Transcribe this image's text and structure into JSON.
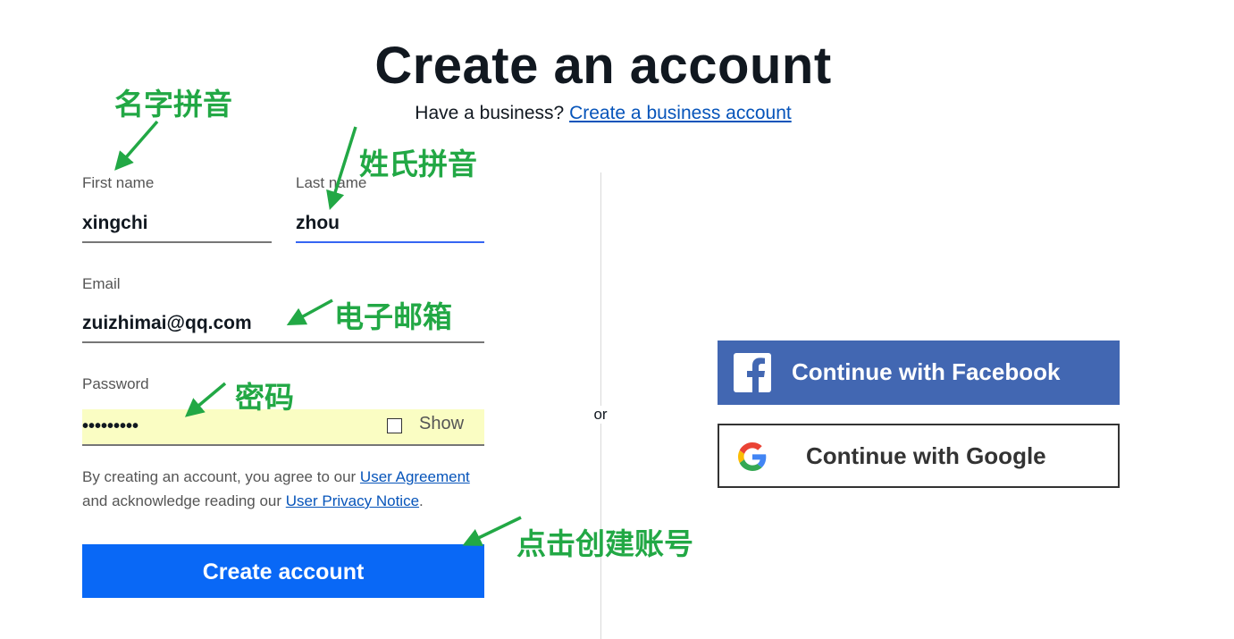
{
  "header": {
    "title": "Create an account",
    "business_prompt": "Have a business?",
    "business_link": "Create a business account"
  },
  "form": {
    "first_name": {
      "label": "First name",
      "value": "xingchi"
    },
    "last_name": {
      "label": "Last name",
      "value": "zhou"
    },
    "email": {
      "label": "Email",
      "value": "zuizhimai@qq.com"
    },
    "password": {
      "label": "Password",
      "value": "•••••••••",
      "show_label": "Show"
    },
    "legal": {
      "text_1": "By creating an account, you agree to our ",
      "link_1": "User Agreement",
      "text_2": " and acknowledge reading our ",
      "link_2": "User Privacy Notice",
      "text_3": "."
    },
    "submit_label": "Create account"
  },
  "divider": {
    "or_text": "or"
  },
  "social": {
    "facebook_label": "Continue with Facebook",
    "google_label": "Continue with Google",
    "facebook_color": "#4267b2"
  },
  "annotations": {
    "first_name": "名字拼音",
    "last_name": "姓氏拼音",
    "email": "电子邮箱",
    "password": "密码",
    "create": "点击创建账号",
    "color": "#22a845"
  },
  "colors": {
    "primary_button": "#0968f6",
    "link": "#0654ba",
    "autofill": "#fafdc3"
  }
}
